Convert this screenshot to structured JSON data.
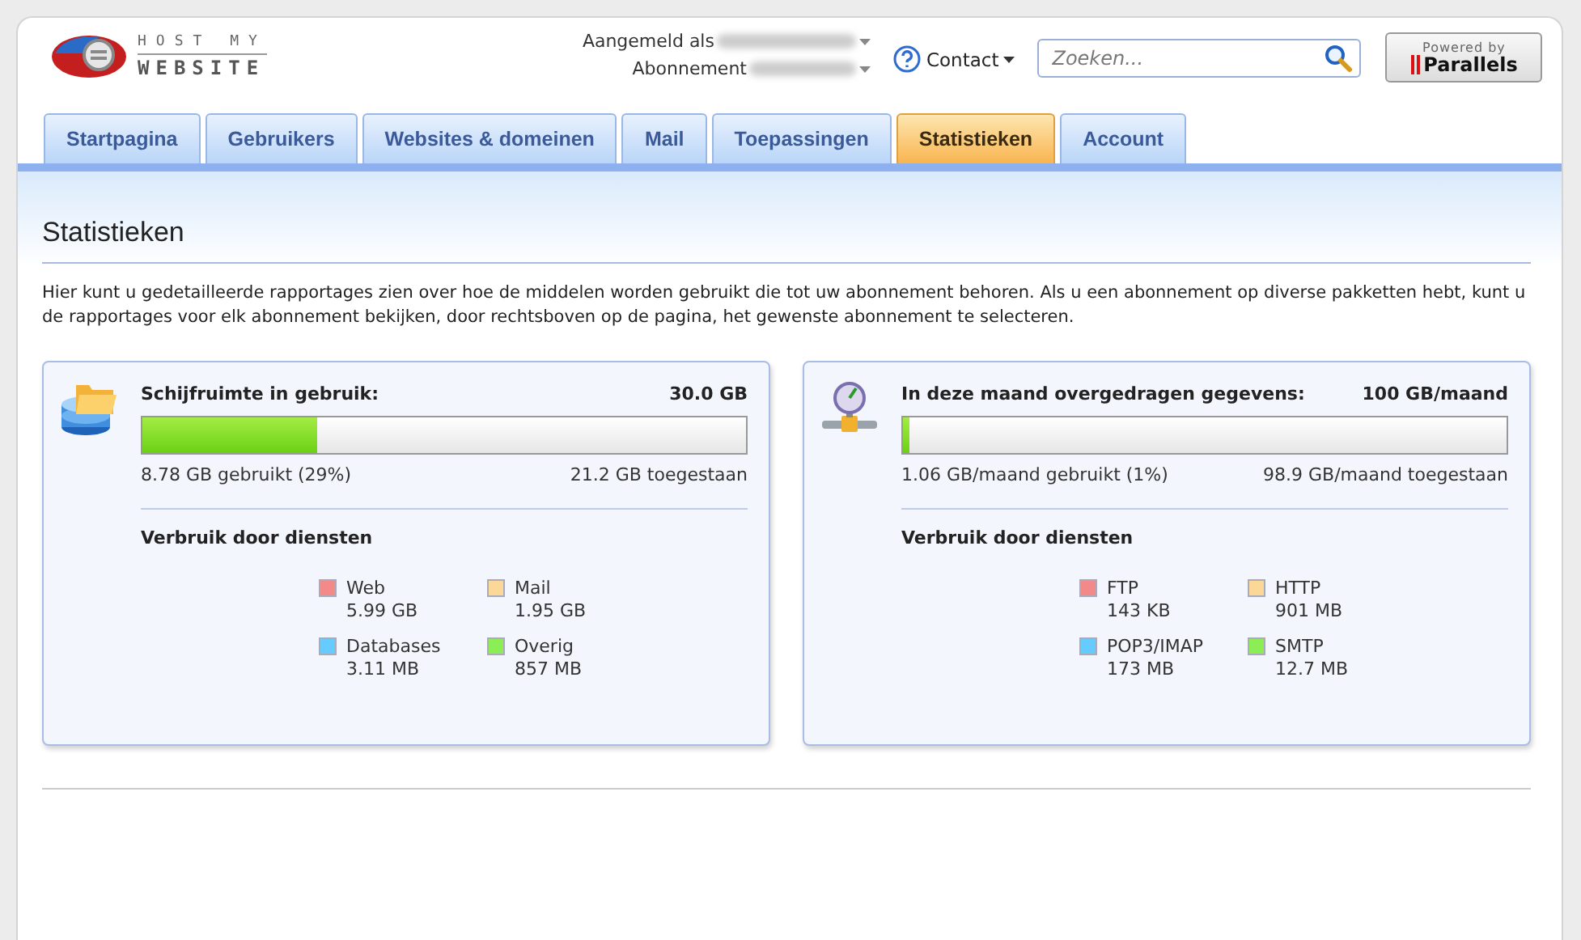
{
  "logo": {
    "line1": "HOST MY",
    "line2": "WEBSITE"
  },
  "account": {
    "signed_in_label": "Aangemeld als",
    "subscription_label": "Abonnement"
  },
  "contact": {
    "label": "Contact"
  },
  "search": {
    "placeholder": "Zoeken..."
  },
  "powered": {
    "line1": "Powered by",
    "line2": "Parallels"
  },
  "tabs": [
    {
      "label": "Startpagina",
      "selected": false
    },
    {
      "label": "Gebruikers",
      "selected": false
    },
    {
      "label": "Websites & domeinen",
      "selected": false
    },
    {
      "label": "Mail",
      "selected": false
    },
    {
      "label": "Toepassingen",
      "selected": false
    },
    {
      "label": "Statistieken",
      "selected": true
    },
    {
      "label": "Account",
      "selected": false
    }
  ],
  "page": {
    "title": "Statistieken",
    "description": "Hier kunt u gedetailleerde rapportages zien over hoe de middelen worden gebruikt die tot uw abonnement behoren. Als u een abonnement op diverse pakketten hebt, kunt u de rapportages voor elk abonnement bekijken, door rechtsboven op de pagina, het gewenste abonnement te selecteren."
  },
  "cards": [
    {
      "kind": "disk",
      "title": "Schijfruimte in gebruik:",
      "total": "30.0 GB",
      "level": 0.29,
      "used": "8.78 GB gebruikt (29%)",
      "allowed": "21.2 GB toegestaan",
      "services_title": "Verbruik door diensten",
      "services": [
        {
          "name": "Web",
          "value": "5.99 GB",
          "color": "#f28a8a"
        },
        {
          "name": "Mail",
          "value": "1.95 GB",
          "color": "#fbd898"
        },
        {
          "name": "Databases",
          "value": "3.11 MB",
          "color": "#66ccff"
        },
        {
          "name": "Overig",
          "value": "857 MB",
          "color": "#8cee55"
        }
      ]
    },
    {
      "kind": "traffic",
      "title": "In deze maand overgedragen gegevens:",
      "total": "100 GB/maand",
      "level": 0.01,
      "used": "1.06 GB/maand gebruikt (1%)",
      "allowed": "98.9 GB/maand toegestaan",
      "services_title": "Verbruik door diensten",
      "services": [
        {
          "name": "FTP",
          "value": "143 KB",
          "color": "#f28a8a"
        },
        {
          "name": "HTTP",
          "value": "901 MB",
          "color": "#fbd898"
        },
        {
          "name": "POP3/IMAP",
          "value": "173 MB",
          "color": "#66ccff"
        },
        {
          "name": "SMTP",
          "value": "12.7 MB",
          "color": "#8cee55"
        }
      ]
    }
  ]
}
